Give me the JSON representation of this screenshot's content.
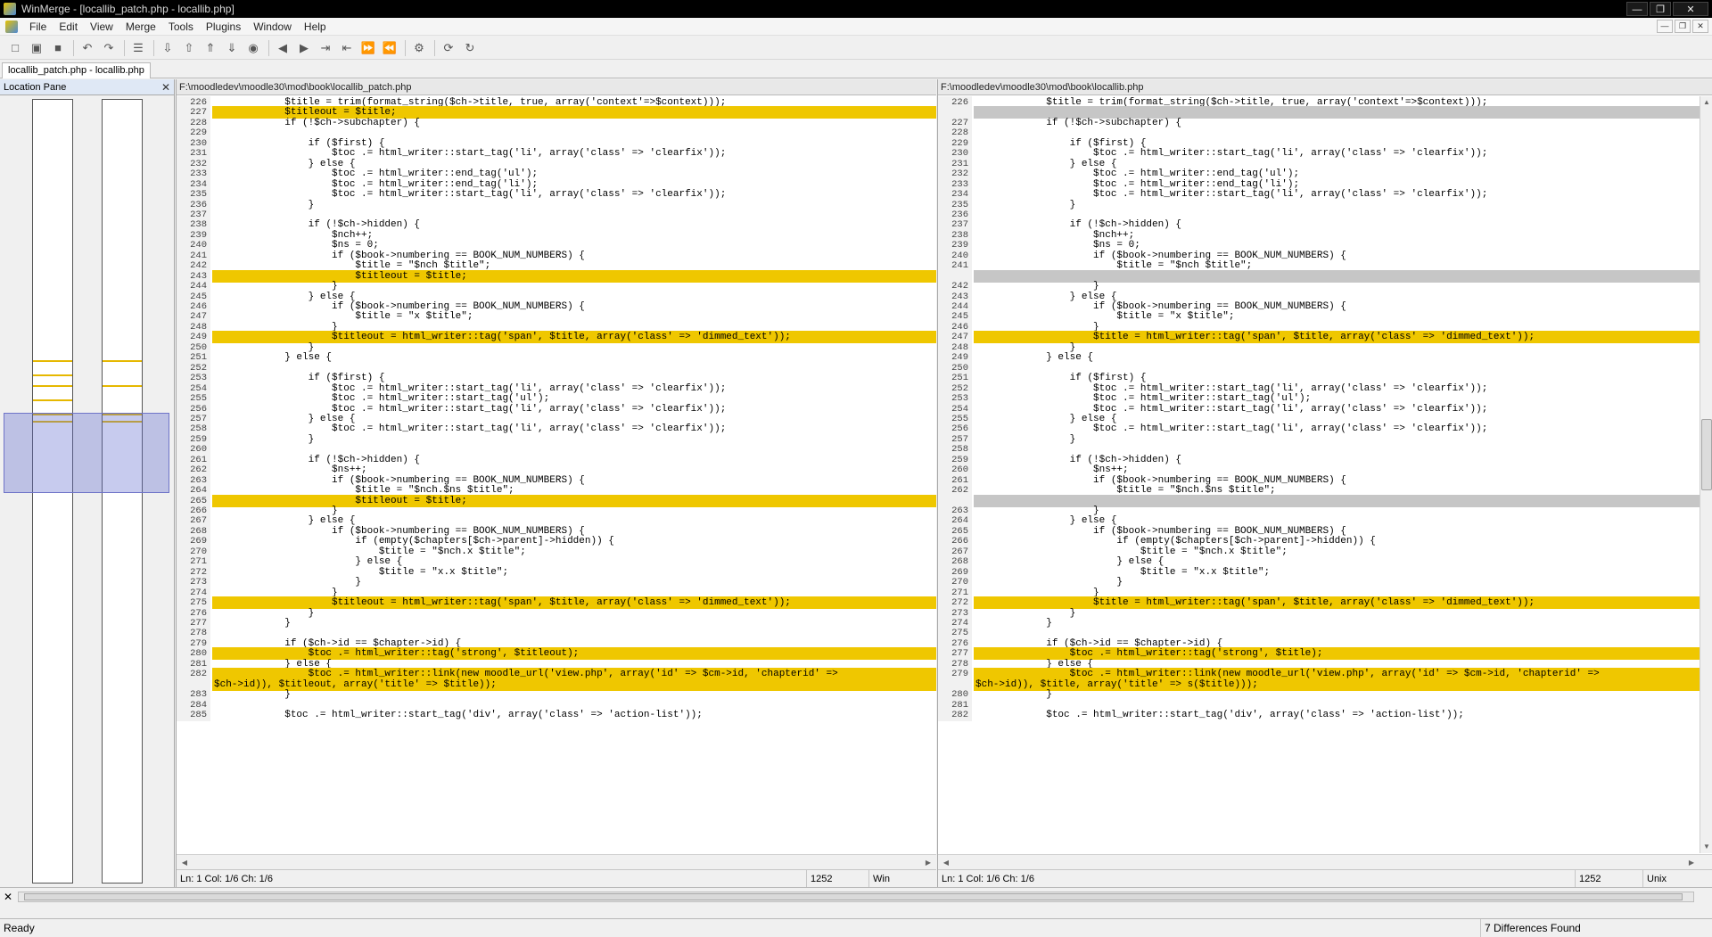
{
  "window": {
    "title": "WinMerge - [locallib_patch.php - locallib.php]"
  },
  "menu": [
    "File",
    "Edit",
    "View",
    "Merge",
    "Tools",
    "Plugins",
    "Window",
    "Help"
  ],
  "tab": {
    "label": "locallib_patch.php - locallib.php"
  },
  "location_pane": {
    "title": "Location Pane"
  },
  "left_pane": {
    "path": "F:\\moodledev\\moodle30\\mod\\book\\locallib_patch.php",
    "rows": [
      {
        "n": "226",
        "t": "            $title = trim(format_string($ch->title, true, array('context'=>$context)));",
        "d": 0
      },
      {
        "n": "227",
        "t": "            $titleout = $title;",
        "d": 1
      },
      {
        "n": "228",
        "t": "            if (!$ch->subchapter) {",
        "d": 0
      },
      {
        "n": "229",
        "t": "",
        "d": 0
      },
      {
        "n": "230",
        "t": "                if ($first) {",
        "d": 0
      },
      {
        "n": "231",
        "t": "                    $toc .= html_writer::start_tag('li', array('class' => 'clearfix'));",
        "d": 0
      },
      {
        "n": "232",
        "t": "                } else {",
        "d": 0
      },
      {
        "n": "233",
        "t": "                    $toc .= html_writer::end_tag('ul');",
        "d": 0
      },
      {
        "n": "234",
        "t": "                    $toc .= html_writer::end_tag('li');",
        "d": 0
      },
      {
        "n": "235",
        "t": "                    $toc .= html_writer::start_tag('li', array('class' => 'clearfix'));",
        "d": 0
      },
      {
        "n": "236",
        "t": "                }",
        "d": 0
      },
      {
        "n": "237",
        "t": "",
        "d": 0
      },
      {
        "n": "238",
        "t": "                if (!$ch->hidden) {",
        "d": 0
      },
      {
        "n": "239",
        "t": "                    $nch++;",
        "d": 0
      },
      {
        "n": "240",
        "t": "                    $ns = 0;",
        "d": 0
      },
      {
        "n": "241",
        "t": "                    if ($book->numbering == BOOK_NUM_NUMBERS) {",
        "d": 0
      },
      {
        "n": "242",
        "t": "                        $title = \"$nch $title\";",
        "d": 0
      },
      {
        "n": "243",
        "t": "                        $titleout = $title;",
        "d": 1
      },
      {
        "n": "244",
        "t": "                    }",
        "d": 0
      },
      {
        "n": "245",
        "t": "                } else {",
        "d": 0
      },
      {
        "n": "246",
        "t": "                    if ($book->numbering == BOOK_NUM_NUMBERS) {",
        "d": 0
      },
      {
        "n": "247",
        "t": "                        $title = \"x $title\";",
        "d": 0
      },
      {
        "n": "248",
        "t": "                    }",
        "d": 0
      },
      {
        "n": "249",
        "t": "                    $titleout = html_writer::tag('span', $title, array('class' => 'dimmed_text'));",
        "d": 1
      },
      {
        "n": "250",
        "t": "                }",
        "d": 0
      },
      {
        "n": "251",
        "t": "            } else {",
        "d": 0
      },
      {
        "n": "252",
        "t": "",
        "d": 0
      },
      {
        "n": "253",
        "t": "                if ($first) {",
        "d": 0
      },
      {
        "n": "254",
        "t": "                    $toc .= html_writer::start_tag('li', array('class' => 'clearfix'));",
        "d": 0
      },
      {
        "n": "255",
        "t": "                    $toc .= html_writer::start_tag('ul');",
        "d": 0
      },
      {
        "n": "256",
        "t": "                    $toc .= html_writer::start_tag('li', array('class' => 'clearfix'));",
        "d": 0
      },
      {
        "n": "257",
        "t": "                } else {",
        "d": 0
      },
      {
        "n": "258",
        "t": "                    $toc .= html_writer::start_tag('li', array('class' => 'clearfix'));",
        "d": 0
      },
      {
        "n": "259",
        "t": "                }",
        "d": 0
      },
      {
        "n": "260",
        "t": "",
        "d": 0
      },
      {
        "n": "261",
        "t": "                if (!$ch->hidden) {",
        "d": 0
      },
      {
        "n": "262",
        "t": "                    $ns++;",
        "d": 0
      },
      {
        "n": "263",
        "t": "                    if ($book->numbering == BOOK_NUM_NUMBERS) {",
        "d": 0
      },
      {
        "n": "264",
        "t": "                        $title = \"$nch.$ns $title\";",
        "d": 0
      },
      {
        "n": "265",
        "t": "                        $titleout = $title;",
        "d": 1
      },
      {
        "n": "266",
        "t": "                    }",
        "d": 0
      },
      {
        "n": "267",
        "t": "                } else {",
        "d": 0
      },
      {
        "n": "268",
        "t": "                    if ($book->numbering == BOOK_NUM_NUMBERS) {",
        "d": 0
      },
      {
        "n": "269",
        "t": "                        if (empty($chapters[$ch->parent]->hidden)) {",
        "d": 0
      },
      {
        "n": "270",
        "t": "                            $title = \"$nch.x $title\";",
        "d": 0
      },
      {
        "n": "271",
        "t": "                        } else {",
        "d": 0
      },
      {
        "n": "272",
        "t": "                            $title = \"x.x $title\";",
        "d": 0
      },
      {
        "n": "273",
        "t": "                        }",
        "d": 0
      },
      {
        "n": "274",
        "t": "                    }",
        "d": 0
      },
      {
        "n": "275",
        "t": "                    $titleout = html_writer::tag('span', $title, array('class' => 'dimmed_text'));",
        "d": 1
      },
      {
        "n": "276",
        "t": "                }",
        "d": 0
      },
      {
        "n": "277",
        "t": "            }",
        "d": 0
      },
      {
        "n": "278",
        "t": "",
        "d": 0
      },
      {
        "n": "279",
        "t": "            if ($ch->id == $chapter->id) {",
        "d": 0
      },
      {
        "n": "280",
        "t": "                $toc .= html_writer::tag('strong', $titleout);",
        "d": 1
      },
      {
        "n": "281",
        "t": "            } else {",
        "d": 0
      },
      {
        "n": "282",
        "t": "                $toc .= html_writer::link(new moodle_url('view.php', array('id' => $cm->id, 'chapterid' =>",
        "d": 1
      },
      {
        "n": "",
        "t": "$ch->id)), $titleout, array('title' => $title));",
        "d": 1
      },
      {
        "n": "283",
        "t": "            }",
        "d": 0
      },
      {
        "n": "284",
        "t": "",
        "d": 0
      },
      {
        "n": "285",
        "t": "            $toc .= html_writer::start_tag('div', array('class' => 'action-list'));",
        "d": 0
      }
    ],
    "status": {
      "pos": "Ln: 1  Col: 1/6  Ch: 1/6",
      "count": "1252",
      "eol": "Win"
    }
  },
  "right_pane": {
    "path": "F:\\moodledev\\moodle30\\mod\\book\\locallib.php",
    "rows": [
      {
        "n": "226",
        "t": "            $title = trim(format_string($ch->title, true, array('context'=>$context)));",
        "d": 0
      },
      {
        "n": "",
        "t": "",
        "d": 2
      },
      {
        "n": "227",
        "t": "            if (!$ch->subchapter) {",
        "d": 0
      },
      {
        "n": "228",
        "t": "",
        "d": 0
      },
      {
        "n": "229",
        "t": "                if ($first) {",
        "d": 0
      },
      {
        "n": "230",
        "t": "                    $toc .= html_writer::start_tag('li', array('class' => 'clearfix'));",
        "d": 0
      },
      {
        "n": "231",
        "t": "                } else {",
        "d": 0
      },
      {
        "n": "232",
        "t": "                    $toc .= html_writer::end_tag('ul');",
        "d": 0
      },
      {
        "n": "233",
        "t": "                    $toc .= html_writer::end_tag('li');",
        "d": 0
      },
      {
        "n": "234",
        "t": "                    $toc .= html_writer::start_tag('li', array('class' => 'clearfix'));",
        "d": 0
      },
      {
        "n": "235",
        "t": "                }",
        "d": 0
      },
      {
        "n": "236",
        "t": "",
        "d": 0
      },
      {
        "n": "237",
        "t": "                if (!$ch->hidden) {",
        "d": 0
      },
      {
        "n": "238",
        "t": "                    $nch++;",
        "d": 0
      },
      {
        "n": "239",
        "t": "                    $ns = 0;",
        "d": 0
      },
      {
        "n": "240",
        "t": "                    if ($book->numbering == BOOK_NUM_NUMBERS) {",
        "d": 0
      },
      {
        "n": "241",
        "t": "                        $title = \"$nch $title\";",
        "d": 0
      },
      {
        "n": "",
        "t": "",
        "d": 2
      },
      {
        "n": "242",
        "t": "                    }",
        "d": 0
      },
      {
        "n": "243",
        "t": "                } else {",
        "d": 0
      },
      {
        "n": "244",
        "t": "                    if ($book->numbering == BOOK_NUM_NUMBERS) {",
        "d": 0
      },
      {
        "n": "245",
        "t": "                        $title = \"x $title\";",
        "d": 0
      },
      {
        "n": "246",
        "t": "                    }",
        "d": 0
      },
      {
        "n": "247",
        "t": "                    $title = html_writer::tag('span', $title, array('class' => 'dimmed_text'));",
        "d": 1
      },
      {
        "n": "248",
        "t": "                }",
        "d": 0
      },
      {
        "n": "249",
        "t": "            } else {",
        "d": 0
      },
      {
        "n": "250",
        "t": "",
        "d": 0
      },
      {
        "n": "251",
        "t": "                if ($first) {",
        "d": 0
      },
      {
        "n": "252",
        "t": "                    $toc .= html_writer::start_tag('li', array('class' => 'clearfix'));",
        "d": 0
      },
      {
        "n": "253",
        "t": "                    $toc .= html_writer::start_tag('ul');",
        "d": 0
      },
      {
        "n": "254",
        "t": "                    $toc .= html_writer::start_tag('li', array('class' => 'clearfix'));",
        "d": 0
      },
      {
        "n": "255",
        "t": "                } else {",
        "d": 0
      },
      {
        "n": "256",
        "t": "                    $toc .= html_writer::start_tag('li', array('class' => 'clearfix'));",
        "d": 0
      },
      {
        "n": "257",
        "t": "                }",
        "d": 0
      },
      {
        "n": "258",
        "t": "",
        "d": 0
      },
      {
        "n": "259",
        "t": "                if (!$ch->hidden) {",
        "d": 0
      },
      {
        "n": "260",
        "t": "                    $ns++;",
        "d": 0
      },
      {
        "n": "261",
        "t": "                    if ($book->numbering == BOOK_NUM_NUMBERS) {",
        "d": 0
      },
      {
        "n": "262",
        "t": "                        $title = \"$nch.$ns $title\";",
        "d": 0
      },
      {
        "n": "",
        "t": "",
        "d": 2
      },
      {
        "n": "263",
        "t": "                    }",
        "d": 0
      },
      {
        "n": "264",
        "t": "                } else {",
        "d": 0
      },
      {
        "n": "265",
        "t": "                    if ($book->numbering == BOOK_NUM_NUMBERS) {",
        "d": 0
      },
      {
        "n": "266",
        "t": "                        if (empty($chapters[$ch->parent]->hidden)) {",
        "d": 0
      },
      {
        "n": "267",
        "t": "                            $title = \"$nch.x $title\";",
        "d": 0
      },
      {
        "n": "268",
        "t": "                        } else {",
        "d": 0
      },
      {
        "n": "269",
        "t": "                            $title = \"x.x $title\";",
        "d": 0
      },
      {
        "n": "270",
        "t": "                        }",
        "d": 0
      },
      {
        "n": "271",
        "t": "                    }",
        "d": 0
      },
      {
        "n": "272",
        "t": "                    $title = html_writer::tag('span', $title, array('class' => 'dimmed_text'));",
        "d": 1
      },
      {
        "n": "273",
        "t": "                }",
        "d": 0
      },
      {
        "n": "274",
        "t": "            }",
        "d": 0
      },
      {
        "n": "275",
        "t": "",
        "d": 0
      },
      {
        "n": "276",
        "t": "            if ($ch->id == $chapter->id) {",
        "d": 0
      },
      {
        "n": "277",
        "t": "                $toc .= html_writer::tag('strong', $title);",
        "d": 1
      },
      {
        "n": "278",
        "t": "            } else {",
        "d": 0
      },
      {
        "n": "279",
        "t": "                $toc .= html_writer::link(new moodle_url('view.php', array('id' => $cm->id, 'chapterid' =>",
        "d": 1
      },
      {
        "n": "",
        "t": "$ch->id)), $title, array('title' => s($title)));",
        "d": 1
      },
      {
        "n": "280",
        "t": "            }",
        "d": 0
      },
      {
        "n": "281",
        "t": "",
        "d": 0
      },
      {
        "n": "282",
        "t": "            $toc .= html_writer::start_tag('div', array('class' => 'action-list'));",
        "d": 0
      }
    ],
    "status": {
      "pos": "Ln: 1  Col: 1/6  Ch: 1/6",
      "count": "1252",
      "eol": "Unix"
    }
  },
  "statusbar": {
    "left": "Ready",
    "right": "7 Differences Found"
  },
  "colors": {
    "diff": "#efc700",
    "ghost": "#c6c6c6",
    "viewport": "#5f69cd"
  },
  "toolbar_icons": [
    "new-icon",
    "open-icon",
    "save-icon",
    "undo-icon",
    "redo-icon",
    "options-icon",
    "next-diff-icon",
    "prev-diff-icon",
    "first-diff-icon",
    "last-diff-icon",
    "current-diff-icon",
    "copy-left-icon",
    "copy-right-icon",
    "copy-right-advance-icon",
    "copy-left-advance-icon",
    "all-right-icon",
    "all-left-icon",
    "auto-merge-icon",
    "refresh-icon",
    "rescan-icon"
  ]
}
